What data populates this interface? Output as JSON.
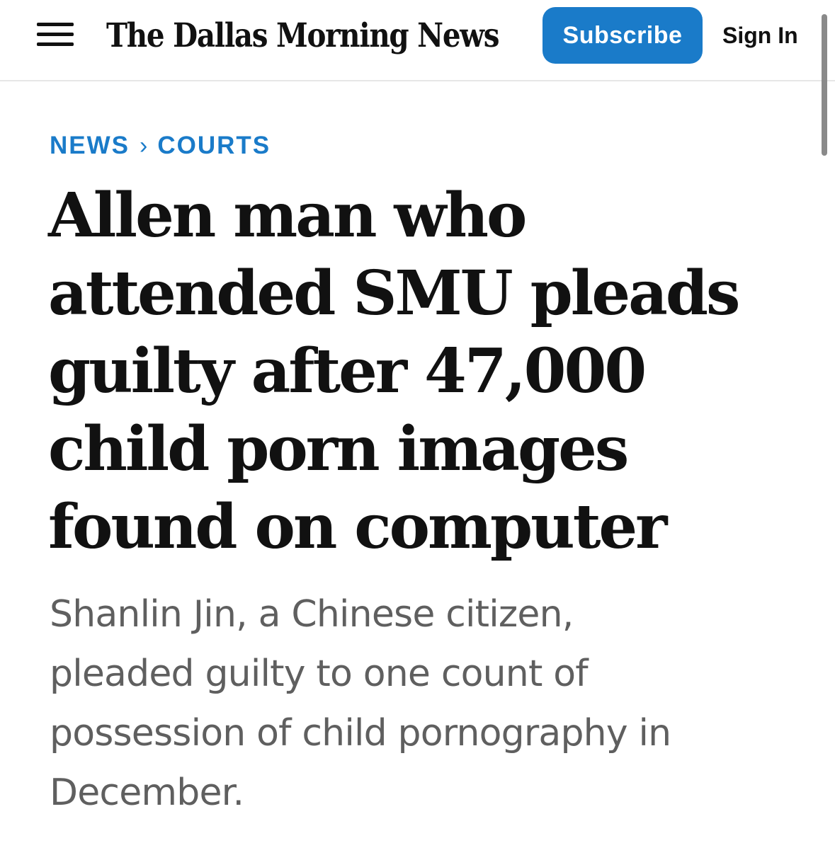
{
  "header": {
    "menu_icon": "hamburger-menu-icon",
    "logo_text": "The Dallas Morning News",
    "subscribe_label": "Subscribe",
    "signin_label": "Sign In"
  },
  "breadcrumb": {
    "items": [
      "NEWS",
      "COURTS"
    ],
    "separator": "›"
  },
  "article": {
    "headline_lines": [
      "Allen man who",
      "attended SMU pleads",
      "guilty after 47,000",
      "child porn images",
      "found on computer"
    ],
    "dek_lines": [
      "Shanlin Jin, a Chinese citizen,",
      "pleaded guilty to one count of",
      "possession of child pornography in",
      "December."
    ]
  },
  "colors": {
    "accent": "#1a7bc9",
    "headline": "#111111",
    "dek": "#5f5f5f",
    "divider": "#e6e6e6"
  }
}
